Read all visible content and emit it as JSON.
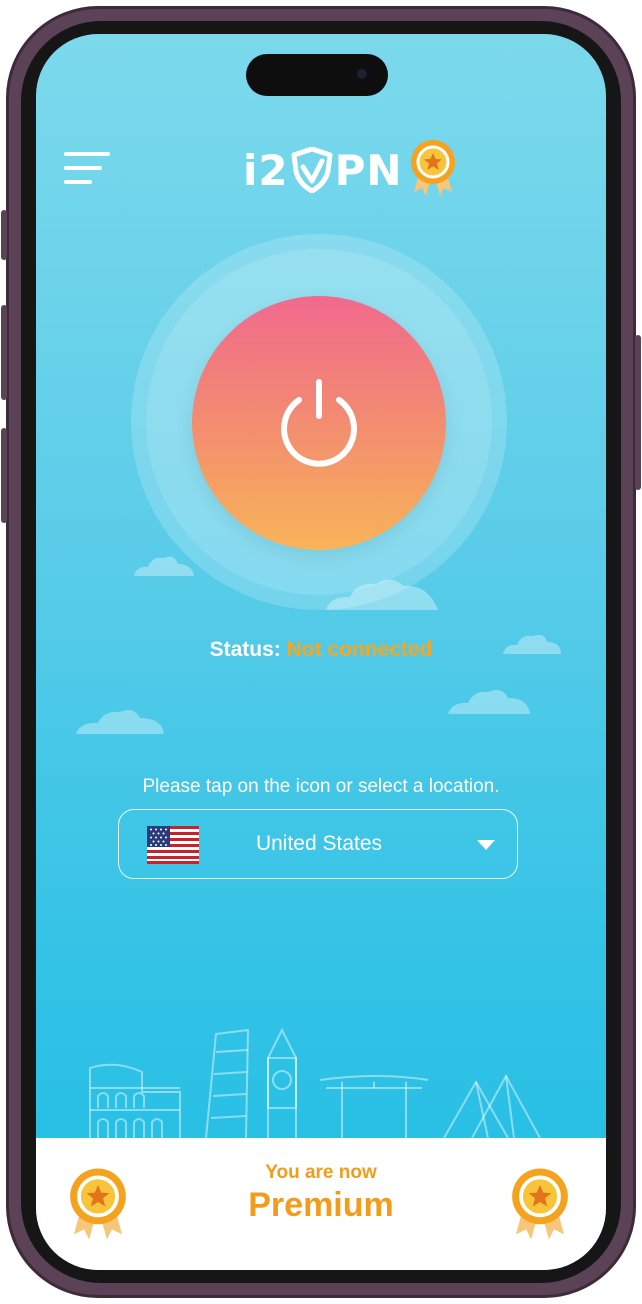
{
  "app": {
    "logo_text_left": "i2",
    "logo_text_right": "PN",
    "menu_icon": "hamburger-menu-icon",
    "badge_icon": "award-medal-icon"
  },
  "connection": {
    "power_icon": "power-icon",
    "status_label": "Status:",
    "status_value": "Not connected"
  },
  "location": {
    "hint": "Please tap on the icon or select a location.",
    "selected": "United States",
    "flag_icon": "us-flag-icon",
    "dropdown_icon": "caret-down-icon"
  },
  "premium": {
    "line1": "You are now",
    "line2": "Premium"
  },
  "colors": {
    "accent_orange": "#f39c1b",
    "status_orange": "#f5a623",
    "button_top": "#f1698d",
    "button_bottom": "#f8b458",
    "sky_top": "#7cd9ec",
    "sky_bottom": "#22bde4"
  }
}
